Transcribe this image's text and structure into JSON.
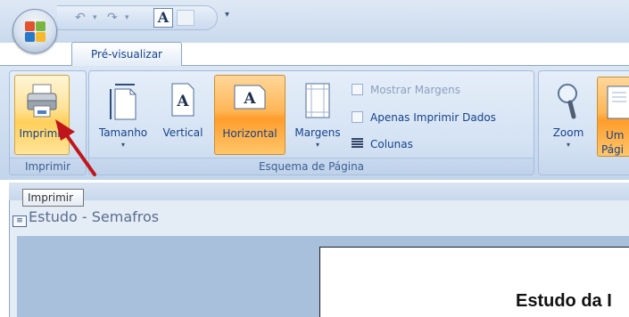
{
  "quick_access": {
    "undo_icon": "undo-icon",
    "redo_icon": "redo-icon",
    "font_button_label": "A",
    "more_glyph": "▾"
  },
  "tabs": [
    {
      "label": "Pré-visualizar",
      "active": true
    }
  ],
  "ribbon": {
    "groups": {
      "imprimir": {
        "label": "Imprimir",
        "print_button_label": "Imprimir"
      },
      "esquema": {
        "label": "Esquema de Página",
        "tamanho_label": "Tamanho",
        "vertical_label": "Vertical",
        "horizontal_label": "Horizontal",
        "margens_label": "Margens",
        "mostrar_margens_label": "Mostrar Margens",
        "apenas_imprimir_label": "Apenas Imprimir Dados",
        "colunas_label": "Colunas"
      },
      "zoom": {
        "zoom_label": "Zoom",
        "uma_pagina_line1": "Um",
        "uma_pagina_line2": "Pági"
      }
    }
  },
  "tooltip": {
    "text": "Imprimir"
  },
  "document": {
    "window_title": "Estudo - Semafros",
    "page_heading": "Estudo da I"
  },
  "colors": {
    "ribbon_text": "#15428b",
    "active_button": "#ffb656",
    "annotation_arrow": "#c0161b"
  }
}
